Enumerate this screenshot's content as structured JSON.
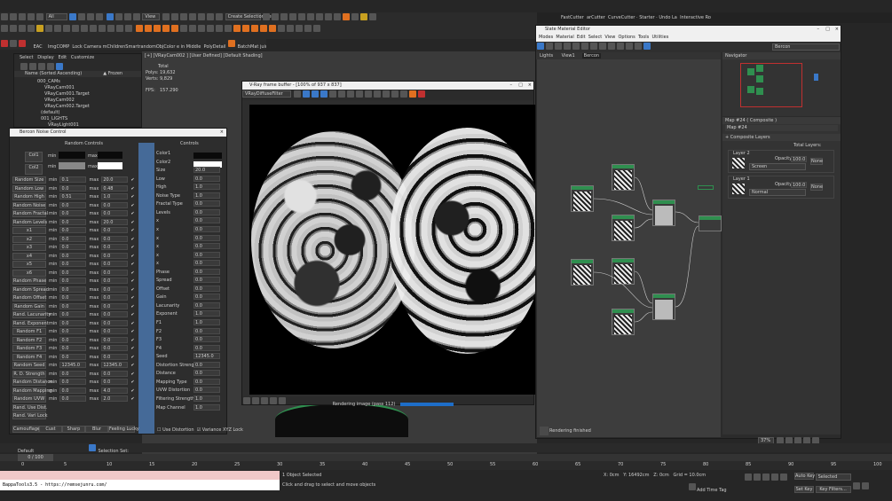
{
  "toolbar": {
    "selection_filter": "All",
    "view_dropdown": "View",
    "create_selection_set": "Create Selection Se"
  },
  "toolbar2": {
    "labels": [
      "EAC",
      "ImgCOMP",
      "Lock Camera",
      "mChildrenSmartrandomObjColor",
      "e in Middle",
      "PolyDetail",
      "BatchMat",
      "juiceboXiiiRc"
    ]
  },
  "top_right_menu": [
    "FastCutter",
    "arCutter",
    "CurveCutter",
    "Starter",
    "Undo La",
    "Interactive Ro"
  ],
  "scene_explorer": {
    "menu": [
      "Select",
      "Display",
      "Edit",
      "Customize"
    ],
    "col_name": "Name (Sorted Ascending)",
    "col_frozen": "▲ Frozen",
    "items": [
      "000_CAMs",
      "VRayCam001",
      "VRayCam001.Target",
      "VRayCam002",
      "VRayCam002.Target",
      "(default)",
      "001_LIGHTS",
      "VRayLight001"
    ]
  },
  "viewport": {
    "label": "[+] [VRayCam002 ] [User Defined] [Default Shading]",
    "stats": [
      [
        "Total",
        ""
      ],
      [
        "Polys:",
        "19,632"
      ],
      [
        "Verts:",
        "9,829"
      ],
      [
        "FPS:",
        "157.290"
      ]
    ]
  },
  "vfb": {
    "title": "V-Ray frame buffer - [100% of 937 x 837]",
    "channel": "VRayDiffuseFilter",
    "status": "Rendering image (pass 112)"
  },
  "bercon": {
    "title": "Bercon Noise Control",
    "left_header": "Random Controls",
    "right_header": "Controls",
    "col1": [
      "Col1",
      "Col2"
    ],
    "col1_min": "min",
    "col1_max": "max",
    "left_rows": [
      [
        "Random Size",
        "min",
        "0.1",
        "max",
        "20.0"
      ],
      [
        "Random Low",
        "min",
        "0.0",
        "max",
        "0.48"
      ],
      [
        "Random High",
        "min",
        "0.51",
        "max",
        "1.0"
      ],
      [
        "Random Noise",
        "min",
        "0.0",
        "max",
        "0.0"
      ],
      [
        "Random Fractal",
        "min",
        "0.0",
        "max",
        "0.0"
      ],
      [
        "Random Levels",
        "min",
        "0.0",
        "max",
        "20.0"
      ],
      [
        "x1",
        "min",
        "0.0",
        "max",
        "0.0"
      ],
      [
        "x2",
        "min",
        "0.0",
        "max",
        "0.0"
      ],
      [
        "x3",
        "min",
        "0.0",
        "max",
        "0.0"
      ],
      [
        "x4",
        "min",
        "0.0",
        "max",
        "0.0"
      ],
      [
        "x5",
        "min",
        "0.0",
        "max",
        "0.0"
      ],
      [
        "x6",
        "min",
        "0.0",
        "max",
        "0.0"
      ],
      [
        "Random Phase",
        "min",
        "0.0",
        "max",
        "0.0"
      ],
      [
        "Random Spread",
        "min",
        "0.0",
        "max",
        "0.0"
      ],
      [
        "Random Offset",
        "min",
        "0.0",
        "max",
        "0.0"
      ],
      [
        "Random Gain",
        "min",
        "0.0",
        "max",
        "0.0"
      ],
      [
        "Rand. Lacunarity",
        "min",
        "0.0",
        "max",
        "0.0"
      ],
      [
        "Rand. Exponent",
        "min",
        "0.0",
        "max",
        "0.0"
      ],
      [
        "Random F1",
        "min",
        "0.0",
        "max",
        "0.0"
      ],
      [
        "Random F2",
        "min",
        "0.0",
        "max",
        "0.0"
      ],
      [
        "Random F3",
        "min",
        "0.0",
        "max",
        "0.0"
      ],
      [
        "Random F4",
        "min",
        "0.0",
        "max",
        "0.0"
      ],
      [
        "Random Seed",
        "min",
        "12345.0",
        "max",
        "12345.0"
      ],
      [
        "R. D. Strength",
        "min",
        "0.0",
        "max",
        "0.0"
      ],
      [
        "Random Distance",
        "min",
        "0.0",
        "max",
        "0.0"
      ],
      [
        "Random Mapping",
        "min",
        "0.0",
        "max",
        "4.0"
      ],
      [
        "Random UVW",
        "min",
        "0.0",
        "max",
        "2.0"
      ],
      [
        "Rand. Use Dist.",
        "",
        "",
        "",
        ""
      ],
      [
        "Rand. Vari Lock",
        "",
        "",
        "",
        ""
      ]
    ],
    "right_rows": [
      [
        "Color1",
        ""
      ],
      [
        "Color2",
        ""
      ],
      [
        "Size",
        "20.0"
      ],
      [
        "Low",
        "0.0"
      ],
      [
        "High",
        "1.0"
      ],
      [
        "Noise Type",
        "1.0"
      ],
      [
        "Fractal Type",
        "0.0"
      ],
      [
        "Levels",
        "0.0"
      ],
      [
        "x",
        "0.0"
      ],
      [
        "x",
        "0.0"
      ],
      [
        "x",
        "0.0"
      ],
      [
        "x",
        "0.0"
      ],
      [
        "x",
        "0.0"
      ],
      [
        "x",
        "0.0"
      ],
      [
        "Phase",
        "0.0"
      ],
      [
        "Spread",
        "0.0"
      ],
      [
        "Offset",
        "0.0"
      ],
      [
        "Gain",
        "0.0"
      ],
      [
        "Lacunarity",
        "0.0"
      ],
      [
        "Exponent",
        "1.0"
      ],
      [
        "F1",
        "1.0"
      ],
      [
        "F2",
        "0.0"
      ],
      [
        "F3",
        "0.0"
      ],
      [
        "F4",
        "0.0"
      ],
      [
        "Seed",
        "12345.0"
      ],
      [
        "Distortion Strength",
        "0.0"
      ],
      [
        "Distance",
        "0.0"
      ],
      [
        "Mapping Type",
        "0.0"
      ],
      [
        "UVW Distortion",
        "0.0"
      ],
      [
        "Filtering Strength",
        "1.0"
      ],
      [
        "Map Channel",
        "1.0"
      ]
    ],
    "bottom_buttons": [
      "Camouflage",
      "Cust",
      "Sharp",
      "Blur",
      "Feeling Lucky"
    ],
    "use_distortion": "Use Distortion",
    "variance_lock": "Variance XYZ Lock"
  },
  "slate": {
    "title": "Slate Material Editor",
    "menu": [
      "Modes",
      "Material",
      "Edit",
      "Select",
      "View",
      "Options",
      "Tools",
      "Utilities"
    ],
    "view_dropdown": "Bercon",
    "tabs": [
      "Lights",
      "View1",
      "Bercon"
    ],
    "navigator": "Navigator",
    "map_title": "Map #24 ( Composite )",
    "map_name": "Map #24",
    "section": "Composite Layers",
    "total_layers": "Total Layers:",
    "layer2": "Layer 2",
    "layer1": "Layer 1",
    "opacity": "Opacity:",
    "opacity_val": "100.0",
    "blend2": "Screen",
    "blend1": "Normal",
    "none": "None",
    "status": "Rendering finished",
    "zoom": "37%"
  },
  "status": {
    "layer": "Default",
    "selection_set": "Selection Set:",
    "frame": "0 / 100",
    "script_url": "BappaTools3.5 - https://remsejunru.com/",
    "selected": "1 Object Selected",
    "hint": "Click and drag to select and move objects",
    "x": "X: 0cm",
    "y": "Y: 16492cm",
    "z": "Z: 0cm",
    "grid": "Grid = 10.0cm",
    "add_time_tag": "Add Time Tag",
    "auto_key": "Auto Key",
    "selected_dd": "Selected",
    "set_key": "Set Key",
    "key_filters": "Key Filters..."
  },
  "timeline_ticks": [
    "0",
    "5",
    "10",
    "15",
    "20",
    "25",
    "30",
    "35",
    "40",
    "45",
    "50",
    "55",
    "60",
    "65",
    "70",
    "75",
    "80",
    "85",
    "90",
    "95",
    "100"
  ]
}
